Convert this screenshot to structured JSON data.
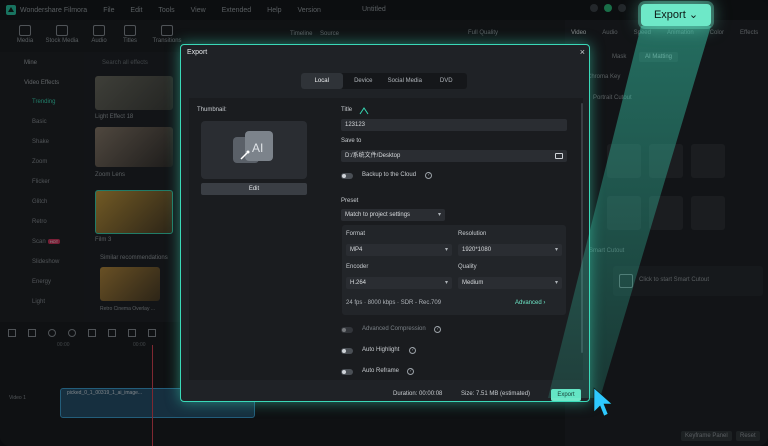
{
  "app": {
    "name": "Wondershare Filmora",
    "menu": [
      "File",
      "Edit",
      "Tools",
      "View",
      "Extended",
      "Help",
      "Version"
    ],
    "doc_title": "Untitled"
  },
  "toolbar": {
    "items": [
      "Media",
      "Stock Media",
      "Audio",
      "Titles",
      "Transitions"
    ]
  },
  "player_bar": {
    "timeline_label": "Timeline",
    "source_label": "Source",
    "quality": "Full Quality"
  },
  "right_panel": {
    "tabs": [
      "Video",
      "Audio",
      "Speed",
      "Animation",
      "Color",
      "Effects"
    ],
    "subtabs": [
      "Mask",
      "AI Matting"
    ],
    "chroma_key": "Chroma Key",
    "portrait_cutout": "Portrait Cutout",
    "smart_cutout": "Smart Cutout",
    "smart_cutout_hint": "Click to start Smart Cutout",
    "keyframe_panel": "Keyframe Panel",
    "reset": "Reset"
  },
  "sidebar": {
    "groups": [
      "Mine",
      "Video Effects"
    ],
    "items": [
      "Trending",
      "Basic",
      "Shake",
      "Zoom",
      "Flicker",
      "Glitch",
      "Retro",
      "Scan",
      "Slideshow",
      "Energy",
      "Light"
    ],
    "active": "Trending",
    "hot_badge": "HOT"
  },
  "browser": {
    "search_placeholder": "Search all effects",
    "effects": [
      "Light Effect 18",
      "Zoom Lens",
      "Film 3"
    ],
    "similar_title": "Similar recommendations",
    "similar_item": "Retro Cinema Overlay ..."
  },
  "timeline": {
    "ruler": [
      "00:00",
      "00:00"
    ],
    "track_label": "Video 1",
    "clip_name": "picked_0_1_00319_1_ai_image..."
  },
  "dialog": {
    "title": "Export",
    "close_glyph": "×",
    "tabs": [
      "Local",
      "Device",
      "Social Media",
      "DVD"
    ],
    "active_tab": "Local",
    "thumbnail_label": "Thumbnail:",
    "edit_label": "Edit",
    "title_label": "Title",
    "title_value": "123123",
    "save_to_label": "Save to",
    "save_to_value": "D:/系统文件/Desktop",
    "backup_label": "Backup to the Cloud",
    "preset_label": "Preset",
    "preset_value": "Match to project settings",
    "format_label": "Format",
    "format_value": "MP4",
    "resolution_label": "Resolution",
    "resolution_value": "1920*1080",
    "encoder_label": "Encoder",
    "encoder_value": "H.264",
    "quality_label": "Quality",
    "quality_value": "Medium",
    "summary": "24 fps · 8000 kbps · SDR - Rec.709",
    "advanced_label": "Advanced",
    "advanced_compression_label": "Advanced Compression",
    "auto_highlight_label": "Auto Highlight",
    "auto_reframe_label": "Auto Reframe",
    "duration_label": "Duration: 00:00:08",
    "size_label": "Size: 7.51 MB (estimated)",
    "export_button": "Export"
  },
  "callout": {
    "export_label": "Export",
    "chevron": "⌄"
  },
  "colors": {
    "accent": "#6ee8c8",
    "accent_glow": "#3ad9b8",
    "panel": "#1f2226",
    "background": "#17191d"
  }
}
